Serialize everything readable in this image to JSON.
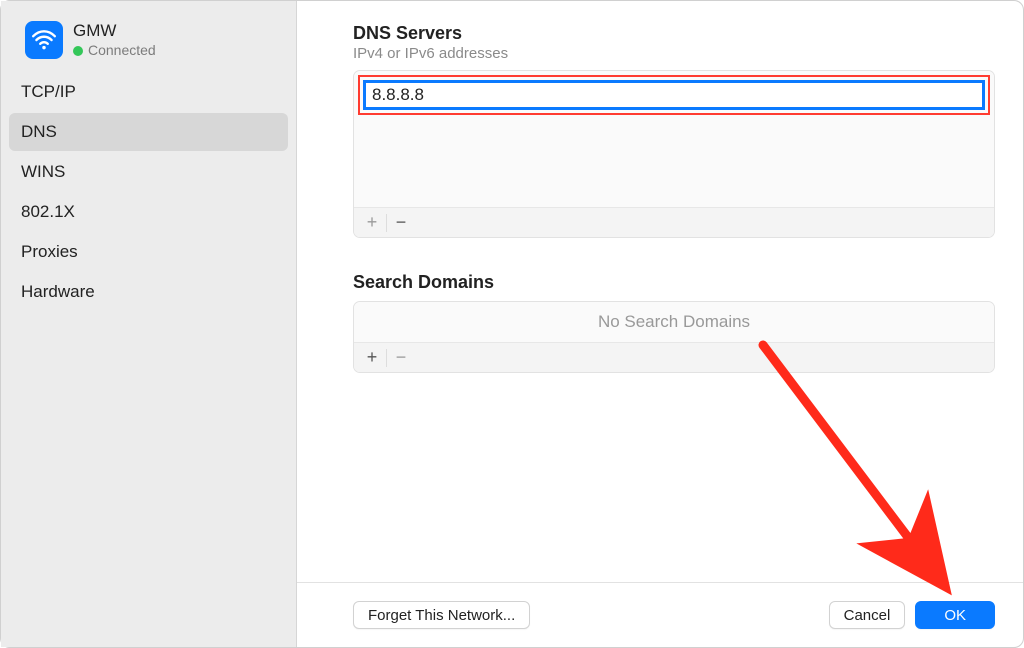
{
  "network": {
    "name": "GMW",
    "status": "Connected"
  },
  "sidebar": {
    "items": [
      {
        "label": "TCP/IP"
      },
      {
        "label": "DNS",
        "selected": true
      },
      {
        "label": "WINS"
      },
      {
        "label": "802.1X"
      },
      {
        "label": "Proxies"
      },
      {
        "label": "Hardware"
      }
    ]
  },
  "dns": {
    "title": "DNS Servers",
    "subtitle": "IPv4 or IPv6 addresses",
    "entries": [
      "8.8.8.8"
    ],
    "add": "+",
    "remove": "−"
  },
  "domains": {
    "title": "Search Domains",
    "empty": "No Search Domains",
    "add": "+",
    "remove": "−"
  },
  "footer": {
    "forget": "Forget This Network...",
    "cancel": "Cancel",
    "ok": "OK"
  }
}
